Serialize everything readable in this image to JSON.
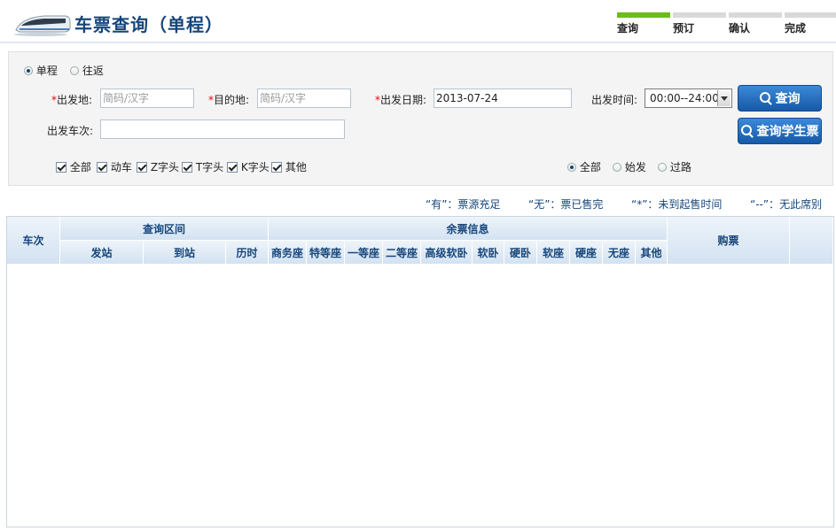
{
  "header": {
    "title": "车票查询（单程）",
    "steps": [
      {
        "label": "查询",
        "active": true
      },
      {
        "label": "预订",
        "active": false
      },
      {
        "label": "确认",
        "active": false
      },
      {
        "label": "完成",
        "active": false
      }
    ]
  },
  "trip_type": {
    "options": [
      {
        "label": "单程",
        "selected": true
      },
      {
        "label": "往返",
        "selected": false
      }
    ]
  },
  "search": {
    "from": {
      "label": "出发地:",
      "placeholder": "简码/汉字"
    },
    "to": {
      "label": "目的地:",
      "placeholder": "简码/汉字"
    },
    "date": {
      "label": "出发日期:",
      "value": "2013-07-24"
    },
    "time": {
      "label": "出发时间:",
      "value": "00:00--24:00"
    },
    "train_no": {
      "label": "出发车次:",
      "value": ""
    },
    "query_button": "查询",
    "student_button": "查询学生票"
  },
  "train_types": [
    {
      "label": "全部",
      "checked": true
    },
    {
      "label": "动车",
      "checked": true
    },
    {
      "label": "Z字头",
      "checked": true
    },
    {
      "label": "T字头",
      "checked": true
    },
    {
      "label": "K字头",
      "checked": true
    },
    {
      "label": "其他",
      "checked": true
    }
  ],
  "station_filter": [
    {
      "label": "全部",
      "selected": true
    },
    {
      "label": "始发",
      "selected": false
    },
    {
      "label": "过路",
      "selected": false
    }
  ],
  "legend": [
    "“有”：票源充足",
    "“无”：票已售完",
    "“*”：未到起售时间",
    "“--”：无此席别"
  ],
  "table": {
    "col_train": "车次",
    "group_interval": "查询区间",
    "group_seats": "余票信息",
    "col_buy": "购票",
    "interval_cols": [
      "发站",
      "到站",
      "历时"
    ],
    "seat_cols": [
      "商务座",
      "特等座",
      "一等座",
      "二等座",
      "高级软卧",
      "软卧",
      "硬卧",
      "软座",
      "硬座",
      "无座",
      "其他"
    ],
    "rows": []
  },
  "colors": {
    "brand_blue": "#16467a",
    "step_active": "#6cbc1a",
    "button_blue": "#1659a8"
  }
}
